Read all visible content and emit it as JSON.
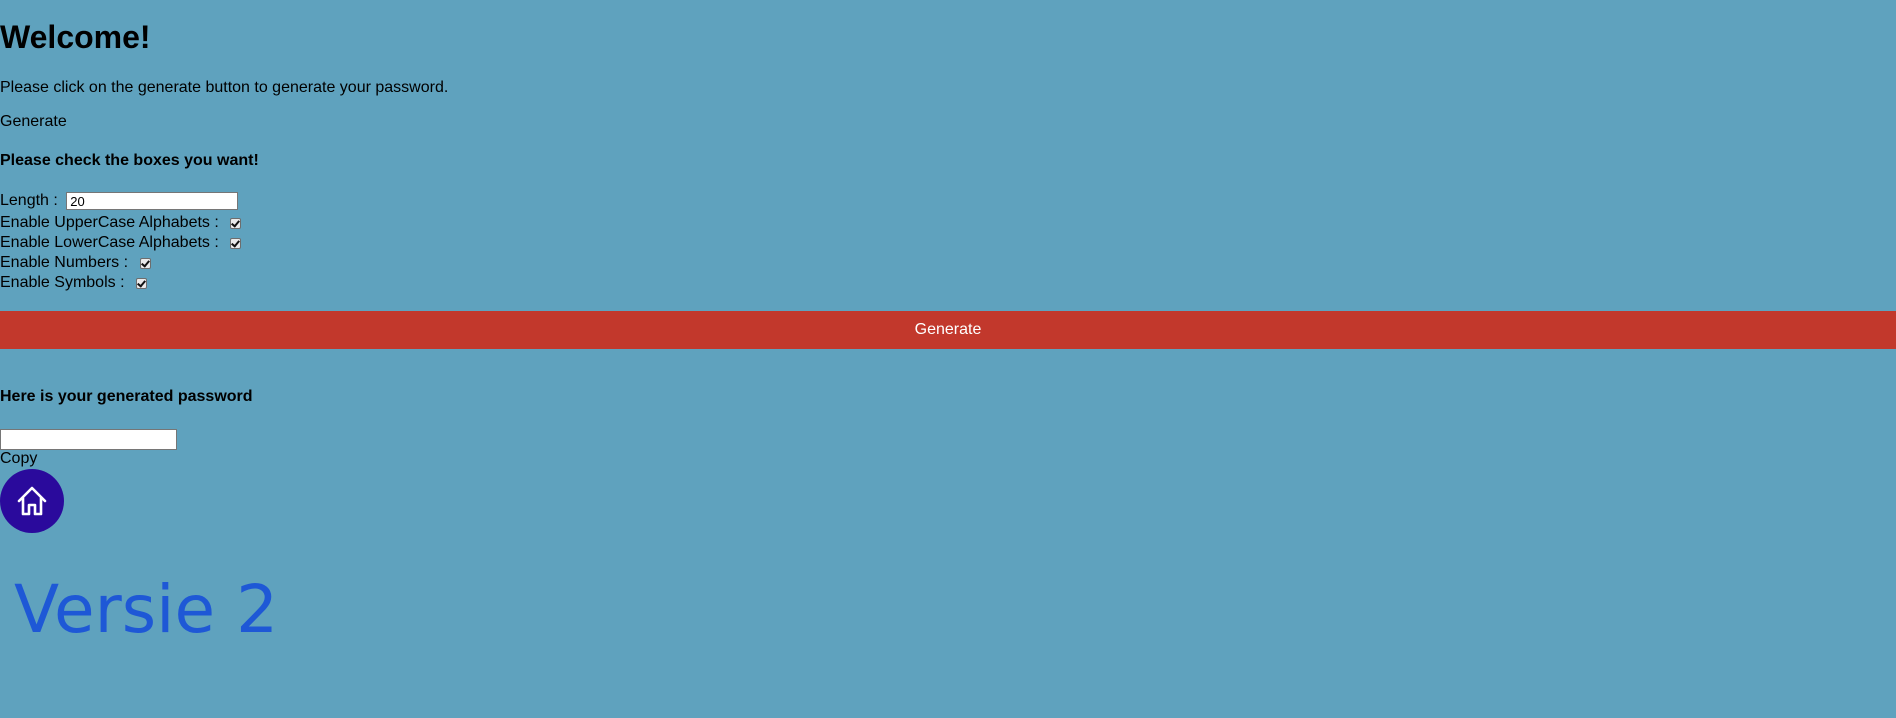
{
  "header": {
    "title": "Welcome!",
    "intro": "Please click on the generate button to generate your password.",
    "generate_link_label": "Generate"
  },
  "options": {
    "heading": "Please check the boxes you want!",
    "length_label": "Length : ",
    "length_value": "20",
    "uppercase_label": "Enable UpperCase Alphabets : ",
    "uppercase_checked": true,
    "lowercase_label": "Enable LowerCase Alphabets : ",
    "lowercase_checked": true,
    "numbers_label": "Enable Numbers : ",
    "numbers_checked": true,
    "symbols_label": "Enable Symbols : ",
    "symbols_checked": true
  },
  "generate_button_label": "Generate",
  "result": {
    "heading": "Here is your generated password",
    "password_value": "",
    "copy_label": "Copy"
  },
  "home_icon": "home-icon",
  "version_label": "Versie 2",
  "colors": {
    "background": "#5fa2be",
    "generate_button": "#c2382c",
    "home_button": "#2a0a9c",
    "version_text": "#1e58d6"
  }
}
